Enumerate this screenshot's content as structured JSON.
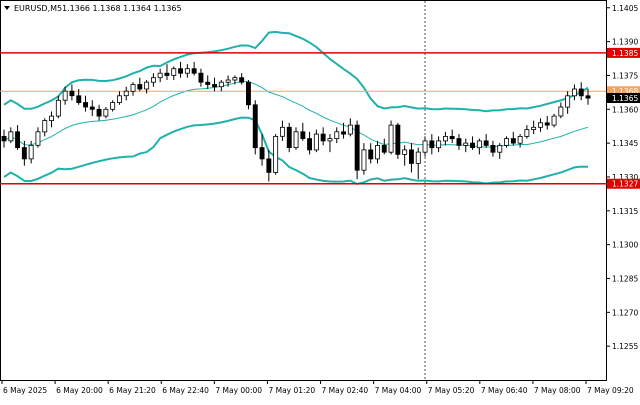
{
  "header": {
    "symbol": "EURUSD,M5",
    "ohlc": "1.1366 1.1368 1.1364 1.1365"
  },
  "colors": {
    "candle": "#000000",
    "bollinger": "#20b2aa",
    "ma": "#20b2aa",
    "resistance": "#e00000",
    "support": "#e00000",
    "current_price_line": "#f4a460",
    "price_tag_bg": "#000000",
    "level_tag_bg": "#e00000",
    "axis": "#000000",
    "grid_vline": "#000000"
  },
  "chart_data": {
    "type": "candlestick",
    "title": "EURUSD,M5",
    "ylim": [
      1.124,
      1.1408
    ],
    "y_ticks": [
      "1.1405",
      "1.1390",
      "1.1375",
      "1.1360",
      "1.1345",
      "1.1330",
      "1.1315",
      "1.1300",
      "1.1285",
      "1.1270",
      "1.1255"
    ],
    "x_ticks": [
      "6 May 2025",
      "6 May 20:00",
      "6 May 21:20",
      "6 May 22:40",
      "7 May 00:00",
      "7 May 01:20",
      "7 May 02:40",
      "7 May 04:00",
      "7 May 05:20",
      "7 May 06:40",
      "7 May 08:00",
      "7 May 09:20"
    ],
    "price_labels": [
      {
        "label": "1.1385",
        "value": 1.1385,
        "kind": "level"
      },
      {
        "label": "1.1368",
        "value": 1.1368,
        "kind": "current"
      },
      {
        "label": "1.1365",
        "value": 1.1365,
        "kind": "bid"
      },
      {
        "label": "1.1327",
        "value": 1.1327,
        "kind": "level"
      }
    ],
    "resistance": 1.1385,
    "support": 1.1327,
    "current_line": 1.1368,
    "session_divider_index": 62,
    "candles": [
      [
        1.1348,
        1.1351,
        1.1343,
        1.1346
      ],
      [
        1.1346,
        1.1352,
        1.1345,
        1.135
      ],
      [
        1.135,
        1.1353,
        1.1342,
        1.1343
      ],
      [
        1.1343,
        1.1346,
        1.1335,
        1.1338
      ],
      [
        1.1338,
        1.1346,
        1.1336,
        1.1344
      ],
      [
        1.1344,
        1.1352,
        1.1343,
        1.135
      ],
      [
        1.135,
        1.1356,
        1.1348,
        1.1355
      ],
      [
        1.1355,
        1.1359,
        1.1352,
        1.1357
      ],
      [
        1.1357,
        1.1366,
        1.1356,
        1.1364
      ],
      [
        1.1364,
        1.137,
        1.1362,
        1.1368
      ],
      [
        1.1368,
        1.1371,
        1.1364,
        1.1366
      ],
      [
        1.1366,
        1.1369,
        1.1362,
        1.1363
      ],
      [
        1.1363,
        1.1366,
        1.1359,
        1.1361
      ],
      [
        1.1361,
        1.1364,
        1.1357,
        1.136
      ],
      [
        1.136,
        1.1362,
        1.1355,
        1.1357
      ],
      [
        1.1357,
        1.1361,
        1.1356,
        1.136
      ],
      [
        1.136,
        1.1364,
        1.1359,
        1.1363
      ],
      [
        1.1363,
        1.1368,
        1.1362,
        1.1366
      ],
      [
        1.1366,
        1.137,
        1.1364,
        1.1368
      ],
      [
        1.1368,
        1.1372,
        1.1366,
        1.1371
      ],
      [
        1.1371,
        1.1374,
        1.1368,
        1.1369
      ],
      [
        1.1369,
        1.1373,
        1.1367,
        1.1372
      ],
      [
        1.1372,
        1.1376,
        1.137,
        1.1374
      ],
      [
        1.1374,
        1.1378,
        1.1372,
        1.1376
      ],
      [
        1.1376,
        1.138,
        1.1373,
        1.1375
      ],
      [
        1.1375,
        1.1379,
        1.1373,
        1.1378
      ],
      [
        1.1378,
        1.1381,
        1.1374,
        1.1376
      ],
      [
        1.1376,
        1.138,
        1.1374,
        1.1378
      ],
      [
        1.1378,
        1.1381,
        1.1375,
        1.1376
      ],
      [
        1.1376,
        1.1378,
        1.137,
        1.1372
      ],
      [
        1.1372,
        1.1375,
        1.1369,
        1.1371
      ],
      [
        1.1371,
        1.1374,
        1.1368,
        1.137
      ],
      [
        1.137,
        1.1373,
        1.1368,
        1.1372
      ],
      [
        1.1372,
        1.1375,
        1.137,
        1.1373
      ],
      [
        1.1373,
        1.1375,
        1.1371,
        1.1374
      ],
      [
        1.1374,
        1.1376,
        1.1371,
        1.1372
      ],
      [
        1.1372,
        1.1373,
        1.136,
        1.1362
      ],
      [
        1.1362,
        1.1364,
        1.134,
        1.1343
      ],
      [
        1.1343,
        1.1349,
        1.1335,
        1.1338
      ],
      [
        1.1338,
        1.1342,
        1.1328,
        1.1332
      ],
      [
        1.1332,
        1.1349,
        1.1331,
        1.1348
      ],
      [
        1.1348,
        1.1355,
        1.1346,
        1.1352
      ],
      [
        1.1352,
        1.1354,
        1.1341,
        1.1343
      ],
      [
        1.1343,
        1.1352,
        1.1342,
        1.135
      ],
      [
        1.135,
        1.1354,
        1.1346,
        1.1347
      ],
      [
        1.1347,
        1.135,
        1.134,
        1.1342
      ],
      [
        1.1342,
        1.1351,
        1.1341,
        1.1349
      ],
      [
        1.1349,
        1.1352,
        1.1344,
        1.1346
      ],
      [
        1.1346,
        1.1349,
        1.1341,
        1.1347
      ],
      [
        1.1347,
        1.1352,
        1.1345,
        1.135
      ],
      [
        1.135,
        1.1354,
        1.1347,
        1.1349
      ],
      [
        1.1349,
        1.1356,
        1.1348,
        1.1353
      ],
      [
        1.1353,
        1.1355,
        1.1329,
        1.1333
      ],
      [
        1.1333,
        1.1345,
        1.1331,
        1.1342
      ],
      [
        1.1342,
        1.1345,
        1.1336,
        1.1338
      ],
      [
        1.1338,
        1.1346,
        1.1336,
        1.1344
      ],
      [
        1.1344,
        1.1347,
        1.134,
        1.1341
      ],
      [
        1.1341,
        1.1355,
        1.134,
        1.1353
      ],
      [
        1.1353,
        1.1354,
        1.1338,
        1.134
      ],
      [
        1.134,
        1.1344,
        1.1335,
        1.1342
      ],
      [
        1.1342,
        1.1345,
        1.1332,
        1.1336
      ],
      [
        1.1336,
        1.1343,
        1.1329,
        1.1341
      ],
      [
        1.1341,
        1.1348,
        1.1339,
        1.1346
      ],
      [
        1.1346,
        1.1349,
        1.134,
        1.1343
      ],
      [
        1.1343,
        1.1348,
        1.1341,
        1.1346
      ],
      [
        1.1346,
        1.135,
        1.1344,
        1.1348
      ],
      [
        1.1348,
        1.1351,
        1.1345,
        1.1347
      ],
      [
        1.1347,
        1.1349,
        1.1342,
        1.1344
      ],
      [
        1.1344,
        1.1347,
        1.1341,
        1.1345
      ],
      [
        1.1345,
        1.1348,
        1.1342,
        1.1343
      ],
      [
        1.1343,
        1.1347,
        1.134,
        1.1346
      ],
      [
        1.1346,
        1.1349,
        1.1343,
        1.1344
      ],
      [
        1.1344,
        1.1346,
        1.1339,
        1.1341
      ],
      [
        1.1341,
        1.1345,
        1.1338,
        1.1344
      ],
      [
        1.1344,
        1.1348,
        1.1343,
        1.1347
      ],
      [
        1.1347,
        1.135,
        1.1344,
        1.1345
      ],
      [
        1.1345,
        1.1349,
        1.1343,
        1.1348
      ],
      [
        1.1348,
        1.1353,
        1.1347,
        1.1351
      ],
      [
        1.1351,
        1.1355,
        1.1349,
        1.1352
      ],
      [
        1.1352,
        1.1356,
        1.135,
        1.1354
      ],
      [
        1.1354,
        1.1357,
        1.1351,
        1.1353
      ],
      [
        1.1353,
        1.1358,
        1.1352,
        1.1357
      ],
      [
        1.1357,
        1.1363,
        1.1356,
        1.1361
      ],
      [
        1.1361,
        1.1368,
        1.1358,
        1.1366
      ],
      [
        1.1366,
        1.1371,
        1.1364,
        1.1369
      ],
      [
        1.1369,
        1.1372,
        1.1364,
        1.1366
      ],
      [
        1.1366,
        1.1369,
        1.1362,
        1.1365
      ]
    ]
  }
}
